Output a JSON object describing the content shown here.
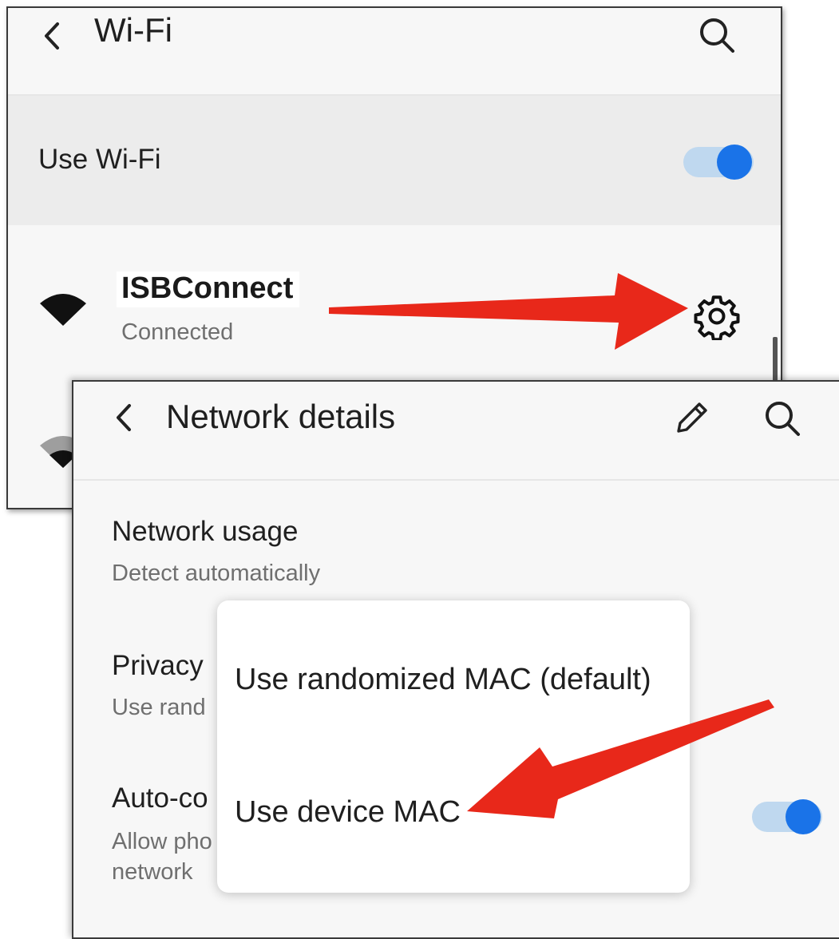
{
  "wifi_screen": {
    "title": "Wi-Fi",
    "use_wifi_label": "Use Wi-Fi",
    "use_wifi_enabled": true,
    "network": {
      "name": "ISBConnect",
      "status": "Connected"
    },
    "icons": [
      "back-arrow-icon",
      "search-icon",
      "wifi-signal-icon",
      "gear-icon"
    ]
  },
  "details_screen": {
    "title": "Network details",
    "network_usage": {
      "title": "Network usage",
      "value": "Detect automatically"
    },
    "privacy": {
      "title_visible": "Privacy",
      "value_visible": "Use rand"
    },
    "auto_connect": {
      "title_visible": "Auto-co",
      "desc_line1_visible": "Allow pho",
      "desc_line2_visible": "network",
      "enabled": true
    },
    "icons": [
      "back-arrow-icon",
      "pencil-icon",
      "search-icon"
    ]
  },
  "mac_popup": {
    "options": [
      "Use randomized MAC (default)",
      "Use device MAC"
    ]
  },
  "colors": {
    "accent": "#1a73e8",
    "arrow": "#e8281a",
    "switch_track": "#bfd8ef"
  }
}
